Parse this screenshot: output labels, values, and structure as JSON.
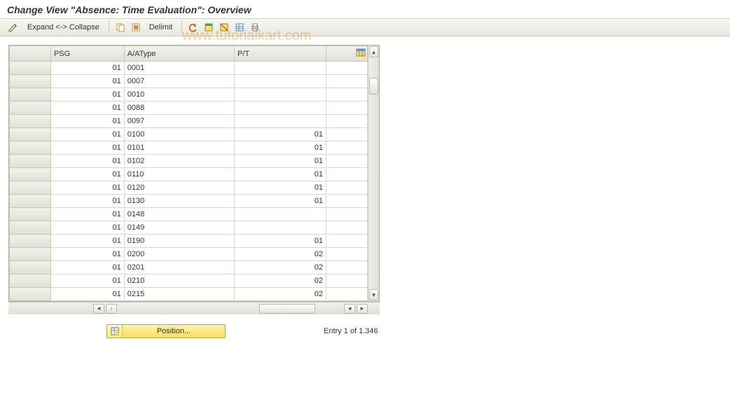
{
  "title": "Change View \"Absence: Time Evaluation\": Overview",
  "toolbar": {
    "expand_collapse_label": "Expand <-> Collapse",
    "delimit_label": "Delimit"
  },
  "columns": {
    "psg": "PSG",
    "atype": "A/AType",
    "pt": "P/T"
  },
  "rows": [
    {
      "psg": "01",
      "atype": "0001",
      "pt": ""
    },
    {
      "psg": "01",
      "atype": "0007",
      "pt": ""
    },
    {
      "psg": "01",
      "atype": "0010",
      "pt": ""
    },
    {
      "psg": "01",
      "atype": "0088",
      "pt": ""
    },
    {
      "psg": "01",
      "atype": "0097",
      "pt": ""
    },
    {
      "psg": "01",
      "atype": "0100",
      "pt": "01"
    },
    {
      "psg": "01",
      "atype": "0101",
      "pt": "01"
    },
    {
      "psg": "01",
      "atype": "0102",
      "pt": "01"
    },
    {
      "psg": "01",
      "atype": "0110",
      "pt": "01"
    },
    {
      "psg": "01",
      "atype": "0120",
      "pt": "01"
    },
    {
      "psg": "01",
      "atype": "0130",
      "pt": "01"
    },
    {
      "psg": "01",
      "atype": "0148",
      "pt": ""
    },
    {
      "psg": "01",
      "atype": "0149",
      "pt": ""
    },
    {
      "psg": "01",
      "atype": "0190",
      "pt": "01"
    },
    {
      "psg": "01",
      "atype": "0200",
      "pt": "02"
    },
    {
      "psg": "01",
      "atype": "0201",
      "pt": "02"
    },
    {
      "psg": "01",
      "atype": "0210",
      "pt": "02"
    },
    {
      "psg": "01",
      "atype": "0215",
      "pt": "02"
    }
  ],
  "footer": {
    "position_label": "Position...",
    "entry_text": "Entry 1 of 1.346"
  },
  "watermark": "www.tutorialkart.com"
}
